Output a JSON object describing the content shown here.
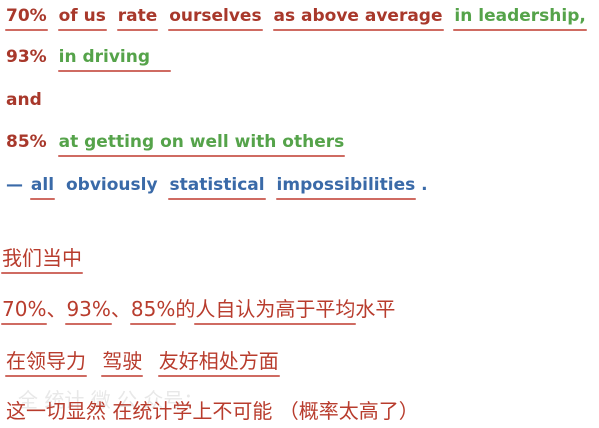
{
  "lines": {
    "l1": {
      "p1": "70%",
      "p2": "of us",
      "p3": "rate",
      "p4": "ourselves",
      "p5": "as above average",
      "p6": "in leadership,"
    },
    "l2": {
      "p1": "93%",
      "p2": "in driving"
    },
    "l3": {
      "p1": "and"
    },
    "l4": {
      "p1": "85%",
      "p2": "at getting on well with others"
    },
    "l5": {
      "p1": "—",
      "p2": "all",
      "p3": "obviously",
      "p4": "statistical",
      "p5": "impossibilities",
      "p6": "."
    },
    "zh1": {
      "p1": "我们当中"
    },
    "zh2": {
      "p1": "70%",
      "p2": "、",
      "p3": "93%",
      "p4": "、",
      "p5": "85%",
      "p6": " 的",
      "p7": "人自认为",
      "p8": "高于平均",
      "p9": "水平"
    },
    "zh3": {
      "p1": "在领导力",
      "p2": "驾驶",
      "p3": "友好相处方面"
    },
    "zh4": {
      "p1": "这一切显然 在统计学上不可能 （概率太高了）"
    }
  },
  "watermark": "全 统计 微 公 众号：",
  "colors": {
    "red": "#a8382b",
    "green": "#55a34a",
    "blue": "#3a6aa8",
    "underline": "#cf6b62"
  }
}
